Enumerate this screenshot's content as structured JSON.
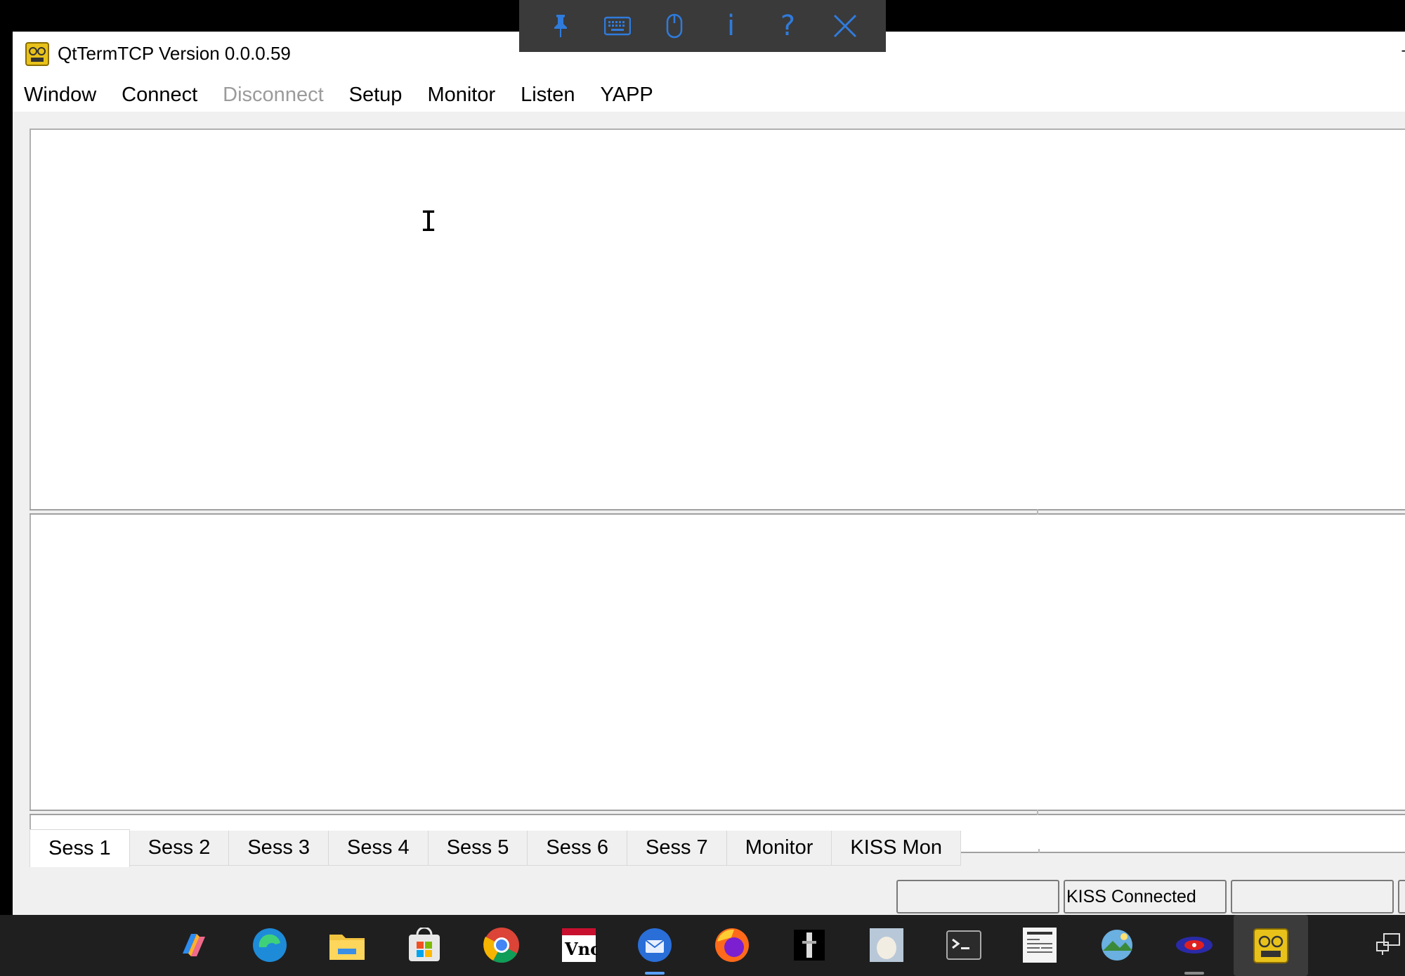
{
  "remote_toolbar": {
    "buttons": [
      {
        "name": "pin-icon"
      },
      {
        "name": "keyboard-icon"
      },
      {
        "name": "mouse-icon"
      },
      {
        "name": "info-icon",
        "glyph": "i"
      },
      {
        "name": "help-icon",
        "glyph": "?"
      },
      {
        "name": "close-icon"
      }
    ],
    "icon_color": "#2f7bdc"
  },
  "window": {
    "title": "QtTermTCP Version 0.0.0.59",
    "minimize_glyph": "–"
  },
  "menu": {
    "items": [
      {
        "label": "Window",
        "enabled": true
      },
      {
        "label": "Connect",
        "enabled": true
      },
      {
        "label": "Disconnect",
        "enabled": false
      },
      {
        "label": "Setup",
        "enabled": true
      },
      {
        "label": "Monitor",
        "enabled": true
      },
      {
        "label": "Listen",
        "enabled": true
      },
      {
        "label": "YAPP",
        "enabled": true
      }
    ]
  },
  "tabs": {
    "items": [
      "Sess 1",
      "Sess 2",
      "Sess 3",
      "Sess 4",
      "Sess 5",
      "Sess 6",
      "Sess 7",
      "Monitor",
      "KISS Mon"
    ],
    "active": "Sess 1"
  },
  "status": {
    "fields": [
      "",
      "KISS Connected",
      "",
      ""
    ]
  },
  "taskbar": {
    "apps": [
      "copilot-icon",
      "edge-icon",
      "file-explorer-icon",
      "store-icon",
      "chrome-icon",
      "vnc-viewer-icon",
      "thunderbird-icon",
      "firefox-icon",
      "dark-app-icon",
      "image-app-icon",
      "terminal-icon",
      "document-app-icon",
      "photo-app-icon",
      "ham-radio-app-icon",
      "qttermtcp-icon"
    ]
  }
}
